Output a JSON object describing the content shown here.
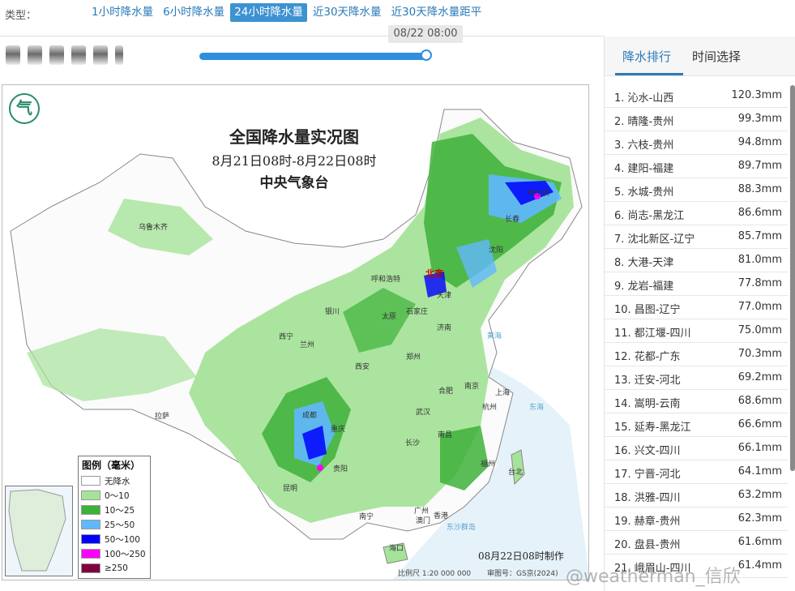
{
  "type_bar": {
    "label": "类型：",
    "tabs": [
      {
        "label": "1小时降水量",
        "active": false
      },
      {
        "label": "6小时降水量",
        "active": false
      },
      {
        "label": "24小时降水量",
        "active": true
      },
      {
        "label": "近30天降水量",
        "active": false
      },
      {
        "label": "近30天降水量距平",
        "active": false
      }
    ]
  },
  "time_slider": {
    "tooltip": "08/22 08:00",
    "position": 1.0
  },
  "map": {
    "title": "全国降水量实况图",
    "subtitle": "8月21日08时-8月22日08时",
    "org": "中央气象台",
    "made_time": "08月22日08时制作",
    "scale": "比例尺 1:20 000 000",
    "review_no": "审图号：GS京(2024)",
    "legend_title": "图例（毫米）",
    "legend": [
      {
        "label": "无降水",
        "color": "#ffffff"
      },
      {
        "label": "0～10",
        "color": "#a6e39a"
      },
      {
        "label": "10～25",
        "color": "#3db23a"
      },
      {
        "label": "25～50",
        "color": "#61b8ff"
      },
      {
        "label": "50～100",
        "color": "#0000fe"
      },
      {
        "label": "100～250",
        "color": "#fa00fa"
      },
      {
        "label": "≥250",
        "color": "#800040"
      }
    ],
    "cities": [
      {
        "name": "乌鲁木齐",
        "cls": ""
      },
      {
        "name": "呼和浩特",
        "cls": ""
      },
      {
        "name": "北京",
        "cls": "capital"
      },
      {
        "name": "天津",
        "cls": ""
      },
      {
        "name": "石家庄",
        "cls": ""
      },
      {
        "name": "太原",
        "cls": ""
      },
      {
        "name": "银川",
        "cls": ""
      },
      {
        "name": "西宁",
        "cls": ""
      },
      {
        "name": "兰州",
        "cls": ""
      },
      {
        "name": "济南",
        "cls": ""
      },
      {
        "name": "郑州",
        "cls": ""
      },
      {
        "name": "西安",
        "cls": ""
      },
      {
        "name": "合肥",
        "cls": ""
      },
      {
        "name": "南京",
        "cls": ""
      },
      {
        "name": "上海",
        "cls": ""
      },
      {
        "name": "杭州",
        "cls": ""
      },
      {
        "name": "武汉",
        "cls": ""
      },
      {
        "name": "成都",
        "cls": ""
      },
      {
        "name": "重庆",
        "cls": ""
      },
      {
        "name": "长沙",
        "cls": ""
      },
      {
        "name": "南昌",
        "cls": ""
      },
      {
        "name": "福州",
        "cls": ""
      },
      {
        "name": "台北",
        "cls": ""
      },
      {
        "name": "贵阳",
        "cls": ""
      },
      {
        "name": "昆明",
        "cls": ""
      },
      {
        "name": "南宁",
        "cls": ""
      },
      {
        "name": "广州",
        "cls": ""
      },
      {
        "name": "香港",
        "cls": ""
      },
      {
        "name": "澳门",
        "cls": ""
      },
      {
        "name": "海口",
        "cls": ""
      },
      {
        "name": "拉萨",
        "cls": ""
      },
      {
        "name": "哈尔滨",
        "cls": ""
      },
      {
        "name": "长春",
        "cls": ""
      },
      {
        "name": "沈阳",
        "cls": ""
      },
      {
        "name": "黄海",
        "cls": "sea"
      },
      {
        "name": "东海",
        "cls": "sea"
      },
      {
        "name": "东沙群岛",
        "cls": "sea"
      }
    ]
  },
  "right_panel": {
    "tabs": [
      {
        "label": "降水排行",
        "active": true
      },
      {
        "label": "时间选择",
        "active": false
      }
    ],
    "ranking": [
      {
        "name": "1. 沁水-山西",
        "value": "120.3mm"
      },
      {
        "name": "2. 晴隆-贵州",
        "value": "99.3mm"
      },
      {
        "name": "3. 六枝-贵州",
        "value": "94.8mm"
      },
      {
        "name": "4. 建阳-福建",
        "value": "89.7mm"
      },
      {
        "name": "5. 水城-贵州",
        "value": "88.3mm"
      },
      {
        "name": "6. 尚志-黑龙江",
        "value": "86.6mm"
      },
      {
        "name": "7. 沈北新区-辽宁",
        "value": "85.7mm"
      },
      {
        "name": "8. 大港-天津",
        "value": "81.0mm"
      },
      {
        "name": "9. 龙岩-福建",
        "value": "77.8mm"
      },
      {
        "name": "10. 昌图-辽宁",
        "value": "77.0mm"
      },
      {
        "name": "11. 都江堰-四川",
        "value": "75.0mm"
      },
      {
        "name": "12. 花都-广东",
        "value": "70.3mm"
      },
      {
        "name": "13. 迁安-河北",
        "value": "69.2mm"
      },
      {
        "name": "14. 嵩明-云南",
        "value": "68.6mm"
      },
      {
        "name": "15. 延寿-黑龙江",
        "value": "66.6mm"
      },
      {
        "name": "16. 兴文-四川",
        "value": "66.1mm"
      },
      {
        "name": "17. 宁晋-河北",
        "value": "64.1mm"
      },
      {
        "name": "18. 洪雅-四川",
        "value": "63.2mm"
      },
      {
        "name": "19. 赫章-贵州",
        "value": "62.3mm"
      },
      {
        "name": "20. 盘县-贵州",
        "value": "61.6mm"
      },
      {
        "name": "21. 峨眉山-四川",
        "value": "61.4mm"
      }
    ]
  },
  "watermark": "@weatherman_信欣"
}
